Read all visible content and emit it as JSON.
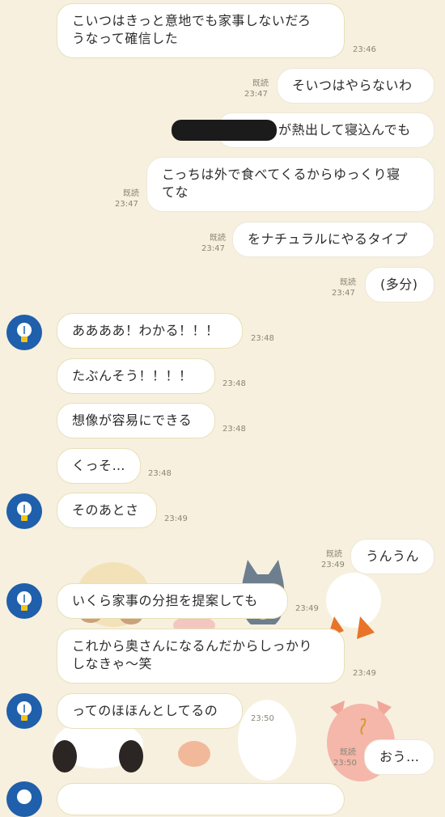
{
  "messages": {
    "m1": {
      "line1": "こいつはきっと意地でも家事しないだろ",
      "line2": "うなって確信した",
      "time": "23:46"
    },
    "m2": {
      "text": "そいつはやらないわ",
      "read": "既読",
      "time": "23:47"
    },
    "m3": {
      "text": "が熱出して寝込んでも"
    },
    "m4": {
      "line1": "こっちは外で食べてくるからゆっくり寝",
      "line2": "てな",
      "read": "既読",
      "time": "23:47"
    },
    "m5": {
      "text": "をナチュラルにやるタイプ",
      "read": "既読",
      "time": "23:47"
    },
    "m6": {
      "text": "(多分)",
      "read": "既読",
      "time": "23:47"
    },
    "m7": {
      "text": "ああああ！わかる！！！",
      "time": "23:48"
    },
    "m8": {
      "text": "たぶんそう！！！！",
      "time": "23:48"
    },
    "m9": {
      "text": "想像が容易にできる",
      "time": "23:48"
    },
    "m10": {
      "text": "くっそ…",
      "time": "23:48"
    },
    "m11": {
      "text": "そのあとさ",
      "time": "23:49"
    },
    "m12": {
      "text": "うんうん",
      "read": "既読",
      "time": "23:49"
    },
    "m13": {
      "text": "いくら家事の分担を提案しても",
      "time": "23:49"
    },
    "m14": {
      "line1": "これから奥さんになるんだからしっかり",
      "line2": "しなきゃ〜笑",
      "time": "23:49"
    },
    "m15": {
      "text": "ってのほほんとしてるの",
      "time": "23:50"
    },
    "m16": {
      "text": "おう…",
      "read": "既読",
      "time": "23:50"
    }
  },
  "colors": {
    "background": "#f7f0df",
    "avatar": "#1f5fab",
    "bubble": "#ffffff"
  },
  "icons": {
    "avatar": "lightbulb-icon"
  }
}
